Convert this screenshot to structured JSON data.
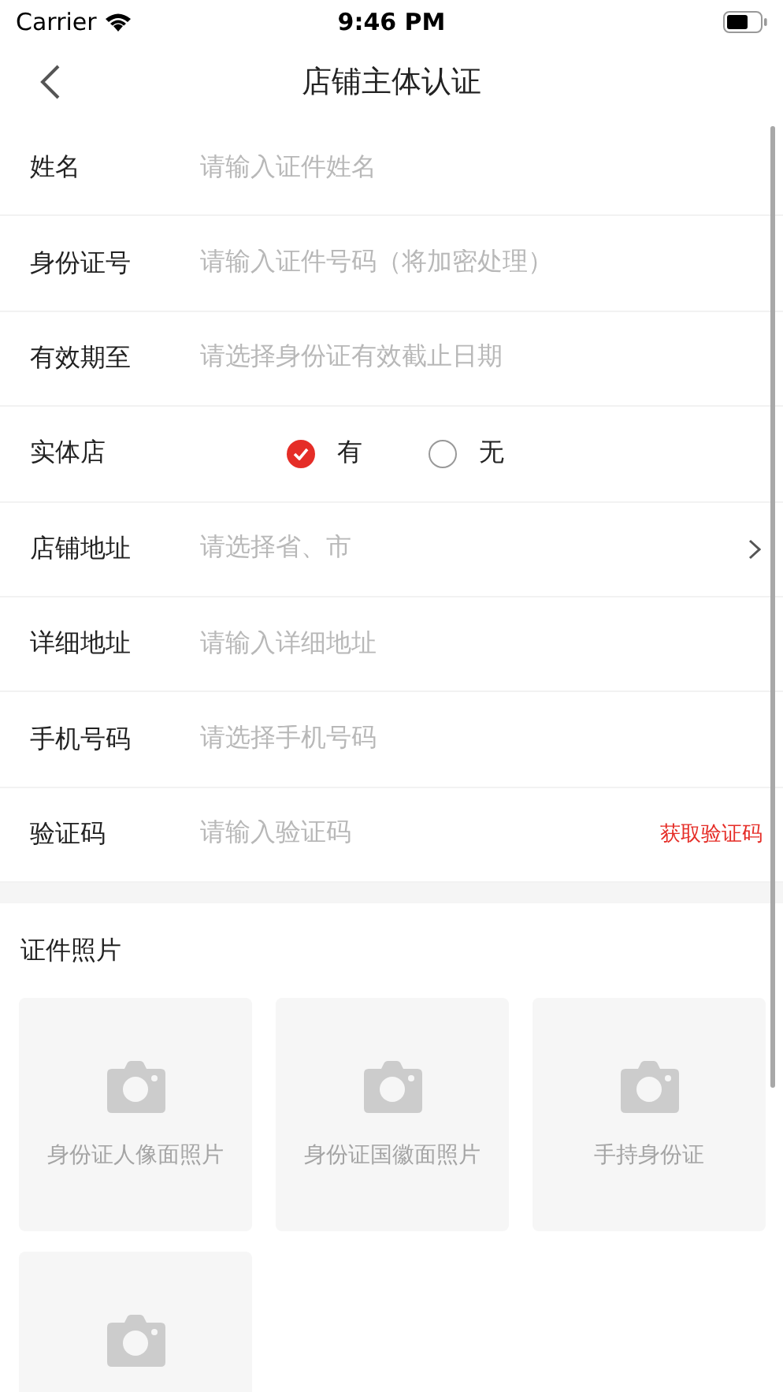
{
  "status_bar": {
    "carrier": "Carrier",
    "time": "9:46 PM"
  },
  "nav": {
    "title": "店铺主体认证"
  },
  "form": [
    {
      "kind": "input",
      "label": "姓名",
      "placeholder": "请输入证件姓名"
    },
    {
      "kind": "input",
      "label": "身份证号",
      "placeholder": "请输入证件号码（将加密处理）"
    },
    {
      "kind": "input",
      "label": "有效期至",
      "placeholder": "请选择身份证有效截止日期"
    },
    {
      "kind": "radio",
      "label": "实体店",
      "options": [
        {
          "label": "有",
          "selected": true
        },
        {
          "label": "无",
          "selected": false
        }
      ]
    },
    {
      "kind": "select",
      "label": "店铺地址",
      "placeholder": "请选择省、市"
    },
    {
      "kind": "input",
      "label": "详细地址",
      "placeholder": "请输入详细地址"
    },
    {
      "kind": "input",
      "label": "手机号码",
      "placeholder": "请选择手机号码"
    },
    {
      "kind": "code",
      "label": "验证码",
      "placeholder": "请输入验证码",
      "action": "获取验证码"
    }
  ],
  "photos": {
    "title": "证件照片",
    "items": [
      {
        "kind": "upload",
        "label": "身份证人像面照片"
      },
      {
        "kind": "upload",
        "label": "身份证国徽面照片"
      },
      {
        "kind": "upload",
        "label": "手持身份证"
      },
      {
        "kind": "upload"
      }
    ]
  }
}
